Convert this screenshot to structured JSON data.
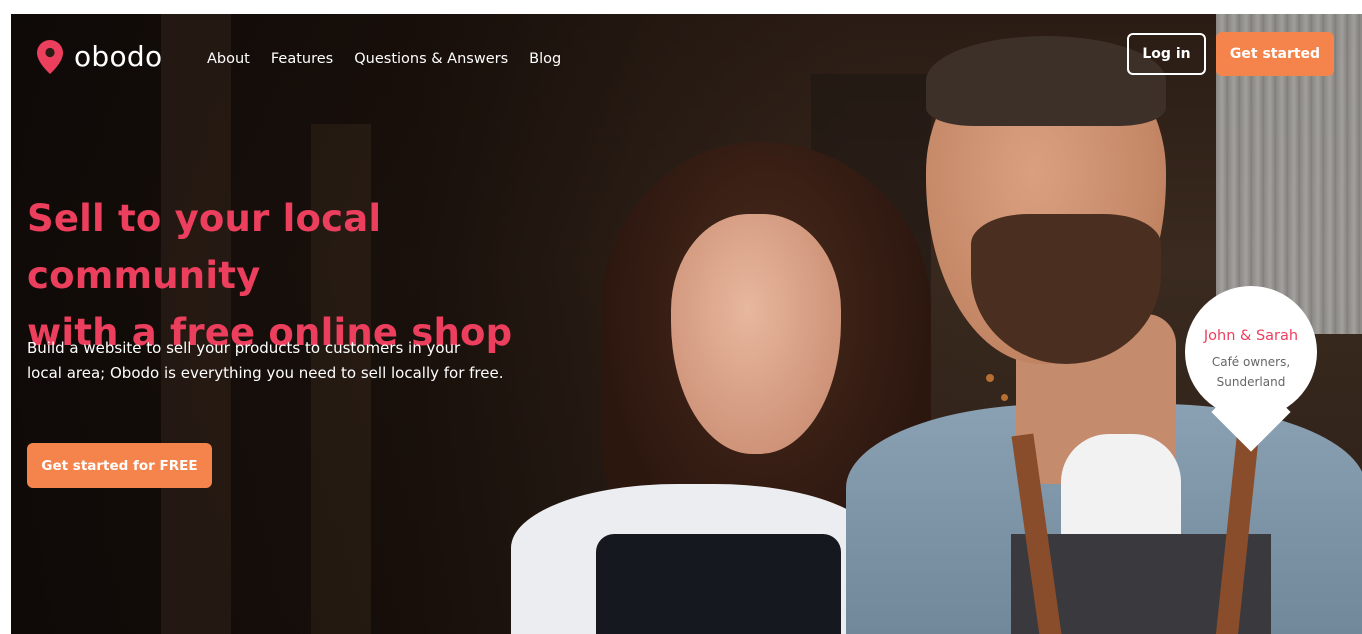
{
  "brand": {
    "name": "obodo",
    "accent_color": "#ec3e5d",
    "cta_color": "#f5844c",
    "logo_icon": "map-pin-icon"
  },
  "nav": {
    "links": [
      "About",
      "Features",
      "Questions & Answers",
      "Blog"
    ],
    "login_label": "Log in",
    "get_started_label": "Get started"
  },
  "hero": {
    "headline_line1": "Sell to your local community",
    "headline_line2": "with a free online shop",
    "subtext_line1": "Build a website to sell your products to customers in your",
    "subtext_line2": "local area; Obodo is everything you need to sell locally for free.",
    "cta_label": "Get started for FREE"
  },
  "testimonial": {
    "name": "John & Sarah",
    "role": "Café owners,",
    "location": "Sunderland"
  }
}
